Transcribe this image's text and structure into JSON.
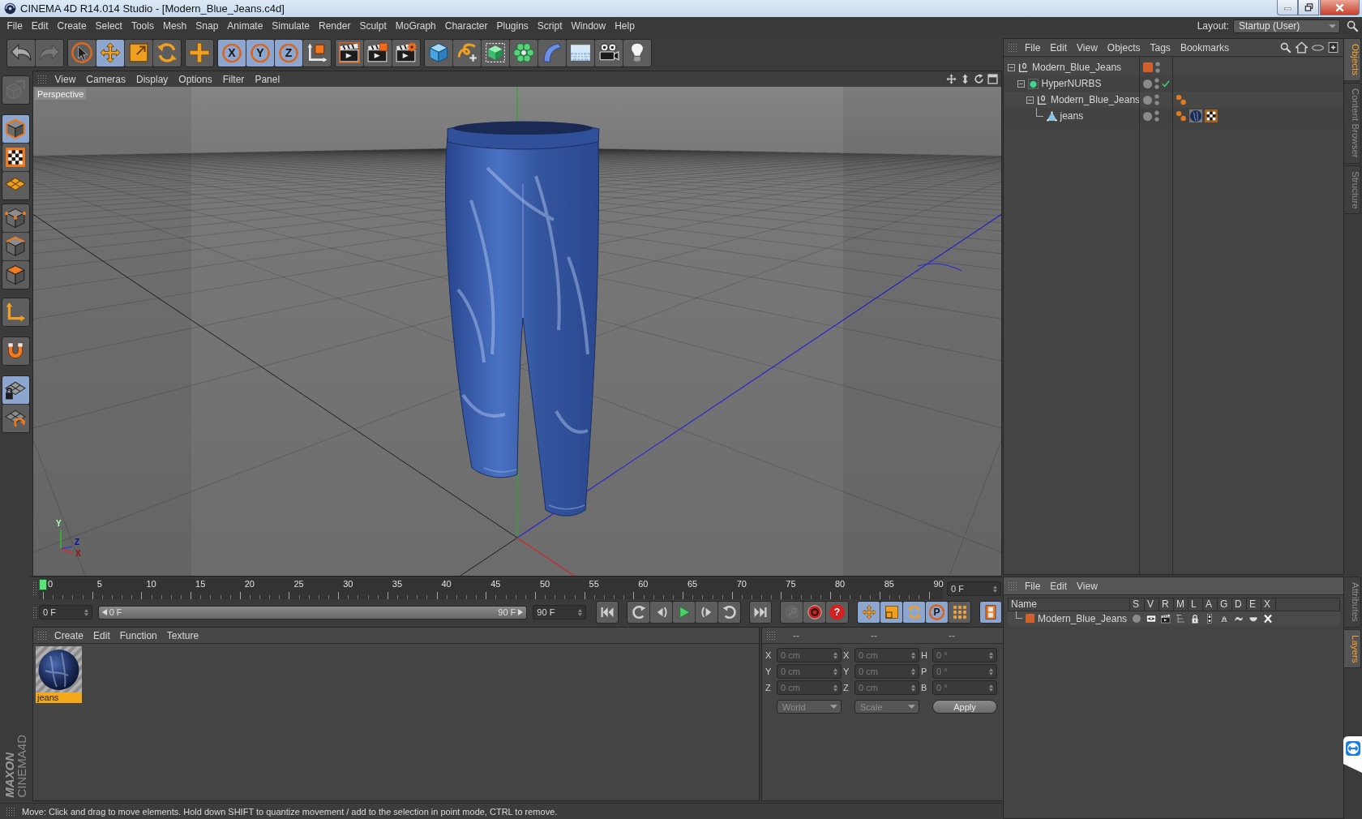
{
  "window": {
    "title": "CINEMA 4D R14.014 Studio - [Modern_Blue_Jeans.c4d]"
  },
  "menu": [
    "File",
    "Edit",
    "Create",
    "Select",
    "Tools",
    "Mesh",
    "Snap",
    "Animate",
    "Simulate",
    "Render",
    "Sculpt",
    "MoGraph",
    "Character",
    "Plugins",
    "Script",
    "Window",
    "Help"
  ],
  "layout": {
    "label": "Layout:",
    "value": "Startup (User)"
  },
  "toolbar": {
    "groups": [
      [
        {
          "kind": "undo",
          "selected": false,
          "disabled": false
        },
        {
          "kind": "redo",
          "selected": false,
          "disabled": true
        }
      ],
      [
        {
          "kind": "live-select",
          "selected": false,
          "disabled": false
        },
        {
          "kind": "move",
          "selected": true,
          "disabled": false
        },
        {
          "kind": "scale",
          "selected": false,
          "disabled": false
        },
        {
          "kind": "rotate",
          "selected": false,
          "disabled": false
        }
      ],
      [
        {
          "kind": "add",
          "selected": false,
          "disabled": false
        }
      ],
      [
        {
          "kind": "axis",
          "label": "X",
          "selected": true,
          "disabled": false
        },
        {
          "kind": "axis",
          "label": "Y",
          "selected": true,
          "disabled": false
        },
        {
          "kind": "axis",
          "label": "Z",
          "selected": true,
          "disabled": false
        },
        {
          "kind": "coord-system",
          "selected": false,
          "disabled": false
        }
      ],
      [
        {
          "kind": "render-view",
          "selected": false,
          "disabled": false
        },
        {
          "kind": "render-picture",
          "selected": false,
          "disabled": false
        },
        {
          "kind": "render-settings",
          "selected": false,
          "disabled": false
        }
      ],
      [
        {
          "kind": "cube",
          "selected": false,
          "disabled": false
        },
        {
          "kind": "spline",
          "selected": false,
          "disabled": false
        },
        {
          "kind": "subdivision",
          "selected": false,
          "disabled": false
        },
        {
          "kind": "cloner",
          "selected": false,
          "disabled": false
        },
        {
          "kind": "deformer",
          "selected": false,
          "disabled": false
        },
        {
          "kind": "floor",
          "selected": false,
          "disabled": false
        },
        {
          "kind": "camera",
          "selected": false,
          "disabled": false
        },
        {
          "kind": "light",
          "selected": false,
          "disabled": false
        }
      ]
    ]
  },
  "left_toolbar": {
    "groups": [
      [
        {
          "kind": "make-editable",
          "selected": false,
          "disabled": true
        }
      ],
      [
        {
          "kind": "model",
          "selected": true,
          "disabled": false
        },
        {
          "kind": "texture",
          "selected": false,
          "disabled": false
        },
        {
          "kind": "workplane",
          "selected": false,
          "disabled": false
        }
      ],
      [
        {
          "kind": "points",
          "selected": false,
          "disabled": false
        },
        {
          "kind": "edges",
          "selected": false,
          "disabled": false
        },
        {
          "kind": "polygons",
          "selected": false,
          "disabled": false
        }
      ],
      [
        {
          "kind": "enable-axis",
          "selected": false,
          "disabled": false
        }
      ],
      [
        {
          "kind": "tweak",
          "selected": false,
          "disabled": false
        }
      ],
      [
        {
          "kind": "locked-workplane",
          "selected": true,
          "disabled": false
        },
        {
          "kind": "planar-workplane",
          "selected": false,
          "disabled": false
        }
      ]
    ]
  },
  "logo": [
    "MAXON",
    "CINEMA4D"
  ],
  "viewport": {
    "menu": [
      "View",
      "Cameras",
      "Display",
      "Options",
      "Filter",
      "Panel"
    ],
    "camera": "Perspective",
    "axis_labels": [
      "Y",
      "Z",
      "X"
    ]
  },
  "timeline": {
    "ticks": [
      "0",
      "5",
      "10",
      "15",
      "20",
      "25",
      "30",
      "35",
      "40",
      "45",
      "50",
      "55",
      "60",
      "65",
      "70",
      "75",
      "80",
      "85",
      "90"
    ],
    "playhead": {
      "level": 0
    },
    "frame": "0 F"
  },
  "transport": {
    "start": "0 F",
    "range": {
      "start": "0 F",
      "end": "90 F",
      "level": 1
    },
    "end": "90 F",
    "groups": [
      [
        {
          "kind": "first-frame",
          "selected": false,
          "disabled": false
        }
      ],
      [
        {
          "kind": "prev-key",
          "selected": false,
          "disabled": false
        },
        {
          "kind": "prev-frame",
          "selected": false,
          "disabled": false
        },
        {
          "kind": "play",
          "selected": false,
          "disabled": false
        },
        {
          "kind": "next-frame",
          "selected": false,
          "disabled": false
        },
        {
          "kind": "next-key",
          "selected": false,
          "disabled": false
        }
      ],
      [
        {
          "kind": "last-frame",
          "selected": false,
          "disabled": false
        }
      ],
      [
        {
          "kind": "key",
          "selected": false,
          "disabled": true
        },
        {
          "kind": "record",
          "selected": false,
          "disabled": false
        },
        {
          "kind": "help",
          "label": "?",
          "selected": false,
          "disabled": false
        }
      ],
      [
        {
          "kind": "move-key",
          "selected": true,
          "disabled": false
        },
        {
          "kind": "scale-key",
          "selected": true,
          "disabled": false
        },
        {
          "kind": "rotate-key",
          "selected": true,
          "disabled": false
        },
        {
          "kind": "param-key",
          "label": "P",
          "selected": true,
          "disabled": false
        },
        {
          "kind": "points-key",
          "selected": false,
          "disabled": false
        }
      ],
      [
        {
          "kind": "timeline",
          "selected": true,
          "disabled": false
        }
      ]
    ]
  },
  "materials": {
    "menu": [
      "Create",
      "Edit",
      "Function",
      "Texture"
    ],
    "items": [
      {
        "name": "jeans",
        "selected": true
      }
    ]
  },
  "coordinates": {
    "headers": [
      "--",
      "--",
      "--"
    ],
    "disabled": true,
    "rows": [
      [
        {
          "label": "X",
          "value": "0 cm"
        },
        {
          "label": "X",
          "value": "0 cm"
        },
        {
          "label": "H",
          "value": "0 °"
        }
      ],
      [
        {
          "label": "Y",
          "value": "0 cm"
        },
        {
          "label": "Y",
          "value": "0 cm"
        },
        {
          "label": "P",
          "value": "0 °"
        }
      ],
      [
        {
          "label": "Z",
          "value": "0 cm"
        },
        {
          "label": "Z",
          "value": "0 cm"
        },
        {
          "label": "B",
          "value": "0 °"
        }
      ]
    ],
    "dropdowns": [
      "World",
      "Scale"
    ],
    "apply": "Apply"
  },
  "status_bar": "Move: Click and drag to move elements. Hold down SHIFT to quantize movement / add to the selection in point mode, CTRL to remove.",
  "objects": {
    "menu": [
      "File",
      "Edit",
      "View",
      "Objects",
      "Tags",
      "Bookmarks"
    ],
    "tree": [
      {
        "name": "Modern_Blue_Jeans",
        "kind": "null",
        "color": "#d2622a",
        "check": false,
        "expanded": true,
        "children": [
          {
            "name": "HyperNURBS",
            "kind": "hypernurbs",
            "check": true,
            "expanded": true,
            "children": [
              {
                "name": "Modern_Blue_Jeans",
                "kind": "null",
                "check": false,
                "expanded": true,
                "tags": [
                  {
                    "kind": "phong"
                  }
                ],
                "children": [
                  {
                    "name": "jeans",
                    "kind": "polygon",
                    "check": false,
                    "expanded": false,
                    "tags": [
                      {
                        "kind": "phong"
                      },
                      {
                        "kind": "material"
                      },
                      {
                        "kind": "uvw"
                      }
                    ]
                  }
                ]
              }
            ]
          }
        ]
      }
    ]
  },
  "layers": {
    "menu": [
      "File",
      "Edit",
      "View"
    ],
    "columns": [
      "Name",
      "S",
      "V",
      "R",
      "M",
      "L",
      "A",
      "G",
      "D",
      "E",
      "X"
    ],
    "rows": [
      {
        "name": "Modern_Blue_Jeans",
        "color": "#d2622a"
      }
    ]
  },
  "side_tabs": {
    "top": [
      {
        "label": "Objects",
        "selected": true
      },
      {
        "label": "Content Browser",
        "selected": false
      },
      {
        "label": "Structure",
        "selected": false
      }
    ],
    "bottom": [
      {
        "label": "Attributes",
        "selected": false
      },
      {
        "label": "Layers",
        "selected": true
      }
    ]
  }
}
